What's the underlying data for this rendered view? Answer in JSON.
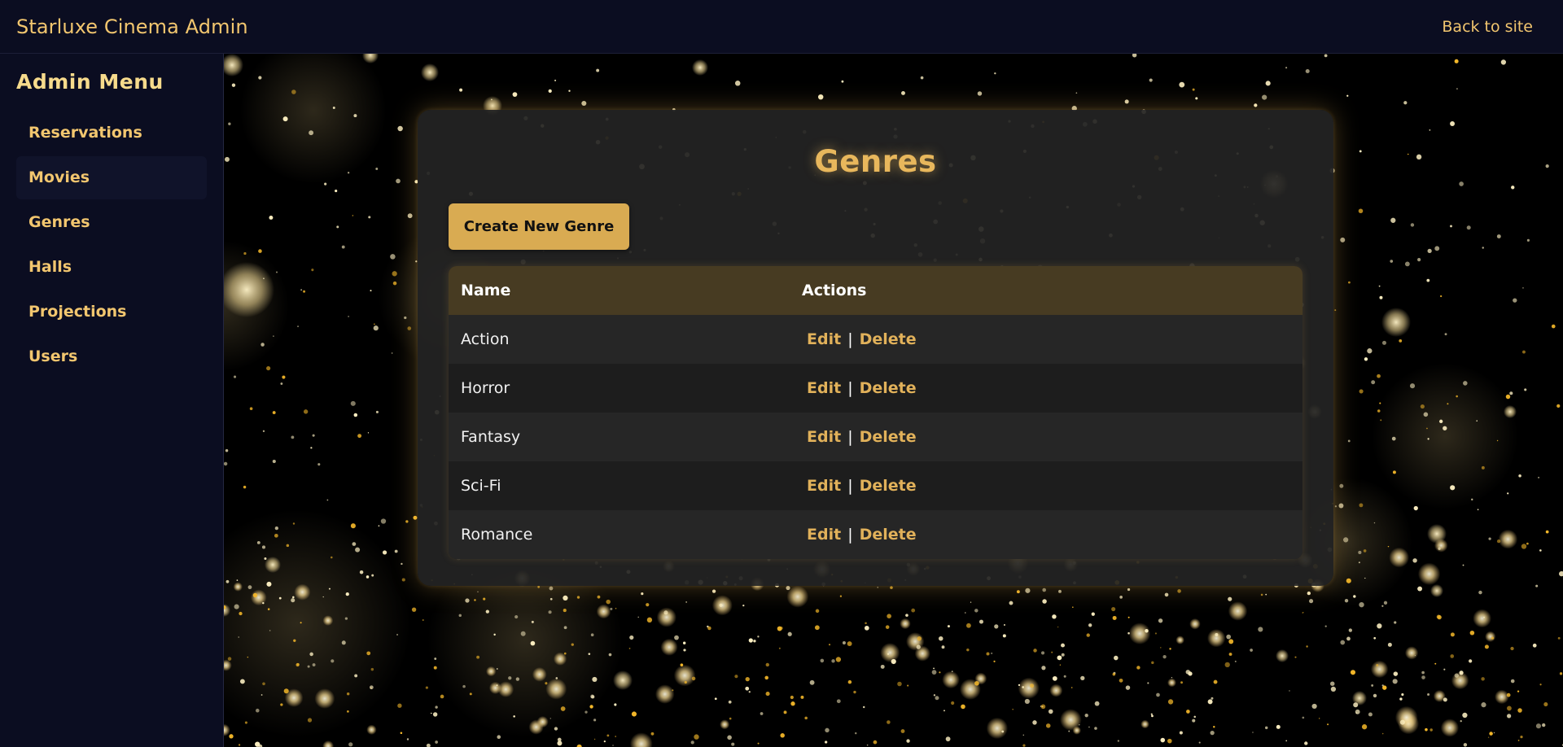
{
  "header": {
    "brand": "Starluxe Cinema Admin",
    "back_link": "Back to site"
  },
  "sidebar": {
    "title": "Admin Menu",
    "items": [
      {
        "label": "Reservations"
      },
      {
        "label": "Movies"
      },
      {
        "label": "Genres"
      },
      {
        "label": "Halls"
      },
      {
        "label": "Projections"
      },
      {
        "label": "Users"
      }
    ]
  },
  "main": {
    "title": "Genres",
    "create_button": "Create New Genre",
    "table": {
      "columns": [
        "Name",
        "Actions"
      ],
      "rows": [
        {
          "name": "Action",
          "edit": "Edit",
          "separator": "|",
          "delete": "Delete"
        },
        {
          "name": "Horror",
          "edit": "Edit",
          "separator": "|",
          "delete": "Delete"
        },
        {
          "name": "Fantasy",
          "edit": "Edit",
          "separator": "|",
          "delete": "Delete"
        },
        {
          "name": "Sci-Fi",
          "edit": "Edit",
          "separator": "|",
          "delete": "Delete"
        },
        {
          "name": "Romance",
          "edit": "Edit",
          "separator": "|",
          "delete": "Delete"
        }
      ]
    }
  },
  "colors": {
    "accent": "#e1b15a",
    "nav_bg": "#0b0d21",
    "button_bg": "#d9ab52",
    "table_header_bg": "#473b22"
  }
}
